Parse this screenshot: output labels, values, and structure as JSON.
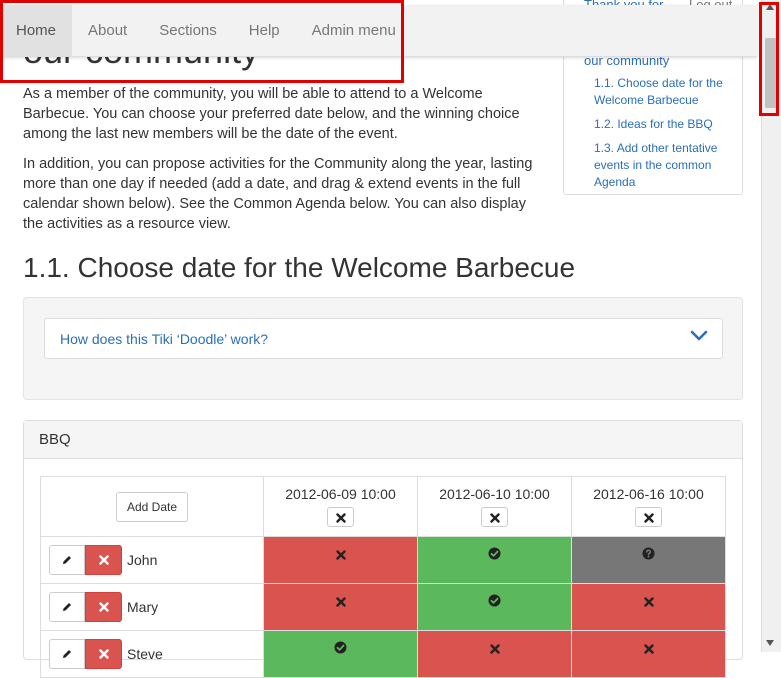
{
  "toc": {
    "top_link": "Thank you for",
    "logout": "Log out",
    "heading": "our community",
    "items": [
      "1.1. Choose date for the Welcome Barbecue",
      "1.2. Ideas for the BBQ",
      "1.3. Add other tentative events in the common Agenda"
    ]
  },
  "navbar": {
    "items": [
      "Home",
      "About",
      "Sections",
      "Help",
      "Admin menu"
    ],
    "active": "Home"
  },
  "page": {
    "heading": "our community",
    "p1": "As a member of the community, you will be able to attend to a Welcome Barbecue. You can choose your preferred date below, and the winning choice among the last new members will be the date of the event.",
    "p2": "In addition, you can propose activities for the Community along the year, lasting more than one day if needed (add a date, and drag & extend events in the full calendar shown below). See the Common Agenda below. You can also display the activities as a resource view.",
    "section_title": "1.1. Choose date for the Welcome Barbecue",
    "accordion_question": "How does this Tiki ‘Doodle’ work?"
  },
  "poll": {
    "panel_title": "BBQ",
    "add_date_label": "Add Date",
    "dates": [
      "2012-06-09 10:00",
      "2012-06-10 10:00",
      "2012-06-16 10:00"
    ],
    "rows": [
      {
        "name": "John",
        "votes": [
          "no",
          "yes",
          "maybe"
        ]
      },
      {
        "name": "Mary",
        "votes": [
          "no",
          "yes",
          "no"
        ]
      },
      {
        "name": "Steve",
        "votes": [
          "yes",
          "no",
          "no"
        ]
      }
    ]
  },
  "colors": {
    "no": "#d9534f",
    "yes": "#5cb85c",
    "maybe": "#777777",
    "link": "#2a6fb8",
    "highlight": "#e00000"
  }
}
